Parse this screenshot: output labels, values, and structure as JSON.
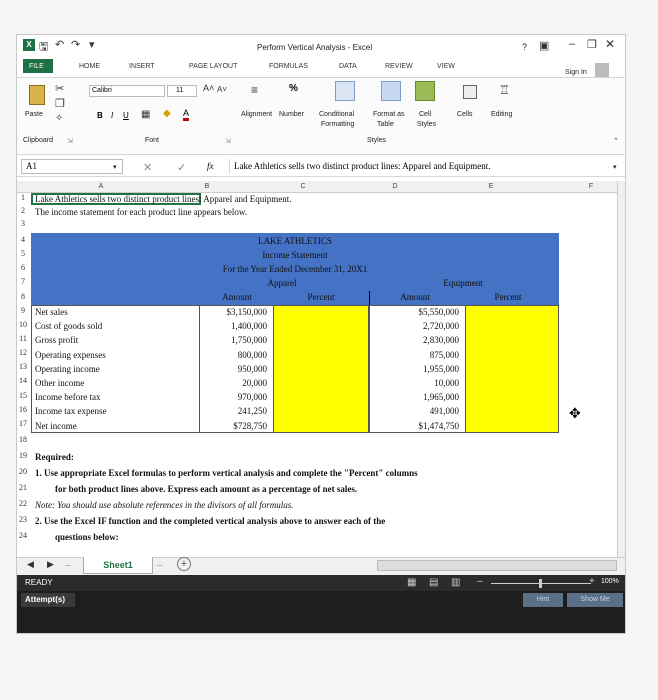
{
  "window": {
    "title": "Perform Vertical Analysis - Excel",
    "help": "?",
    "sign_in": "Sign In"
  },
  "tabs": [
    "FILE",
    "HOME",
    "INSERT",
    "PAGE LAYOUT",
    "FORMULAS",
    "DATA",
    "REVIEW",
    "VIEW"
  ],
  "ribbon": {
    "paste": "Paste",
    "clipboard": "Clipboard",
    "font_name": "Calibri",
    "font_size": "11",
    "font_group": "Font",
    "bold": "B",
    "italic": "I",
    "underline": "U",
    "alignment": "Alignment",
    "number": "Number",
    "conditional": "Conditional",
    "formatting": "Formatting",
    "format_as": "Format as",
    "table": "Table",
    "cell": "Cell",
    "styles_btn": "Styles",
    "styles_group": "Styles",
    "cells": "Cells",
    "editing": "Editing",
    "percent": "%"
  },
  "formula_bar": {
    "name_box": "A1",
    "fx": "fx",
    "content": "Lake Athletics sells two distinct product lines: Apparel and Equipment."
  },
  "columns": [
    "A",
    "B",
    "C",
    "D",
    "E",
    "F"
  ],
  "rows": [
    "1",
    "2",
    "3",
    "4",
    "5",
    "6",
    "7",
    "8",
    "9",
    "10",
    "11",
    "12",
    "13",
    "14",
    "15",
    "16",
    "17",
    "18",
    "19",
    "20",
    "21",
    "22",
    "23",
    "24"
  ],
  "sheet": {
    "r1": "Lake Athletics sells two distinct product lines: Apparel and Equipment.",
    "r2": "The income statement for each product line appears below.",
    "company": "LAKE ATHLETICS",
    "statement": "Income Statement",
    "period": "For the Year Ended December 31, 20X1",
    "apparel": "Apparel",
    "equipment": "Equipment",
    "amount": "Amount",
    "percent": "Percent",
    "lines": [
      {
        "label": "Net sales",
        "apparel": "$3,150,000",
        "equipment": "$5,550,000"
      },
      {
        "label": "Cost of goods sold",
        "apparel": "1,400,000",
        "equipment": "2,720,000"
      },
      {
        "label": "Gross profit",
        "apparel": "1,750,000",
        "equipment": "2,830,000"
      },
      {
        "label": "Operating expenses",
        "apparel": "800,000",
        "equipment": "875,000"
      },
      {
        "label": "Operating income",
        "apparel": "950,000",
        "equipment": "1,955,000"
      },
      {
        "label": "Other income",
        "apparel": "20,000",
        "equipment": "10,000"
      },
      {
        "label": "Income before tax",
        "apparel": "970,000",
        "equipment": "1,965,000"
      },
      {
        "label": "Income tax expense",
        "apparel": "241,250",
        "equipment": "491,000"
      },
      {
        "label": "Net income",
        "apparel": "$728,750",
        "equipment": "$1,474,750"
      }
    ],
    "required": "Required:",
    "q1a": "1. Use appropriate Excel formulas to perform vertical analysis and complete the \"Percent\" columns",
    "q1b": "for both product lines above. Express each amount as a percentage of net sales.",
    "note": "Note: You should use absolute references in the divisors of all formulas.",
    "q2a": "2. Use the Excel IF function and the completed vertical analysis above to answer each of the",
    "q2b": "questions below:"
  },
  "sheet_tab": "Sheet1",
  "status": {
    "ready": "READY",
    "attempts": "Attempt(s)",
    "zoom": "100%",
    "hint": "Hint",
    "show_me": "Show Me",
    "more": "..."
  },
  "colors": {
    "header_blue": "#4472c4",
    "percent_yellow": "#ffff00",
    "status_bar": "#1e1e1e"
  }
}
